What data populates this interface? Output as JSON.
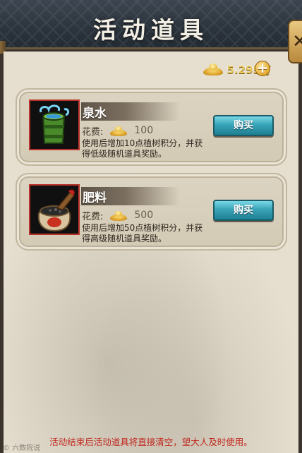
{
  "header": {
    "title": "活动道具",
    "close_label": "✕"
  },
  "currency": {
    "amount": "5.295万",
    "plus_label": "+"
  },
  "items": [
    {
      "name": "泉水",
      "cost_label": "花费:",
      "cost_value": "100",
      "description": "使用后增加10点植树积分，并获得低级随机道具奖励。",
      "buy_label": "购买",
      "icon": "bamboo-water-bucket-icon"
    },
    {
      "name": "肥料",
      "cost_label": "花费:",
      "cost_value": "500",
      "description": "使用后增加50点植树积分，并获得高级随机道具奖励。",
      "buy_label": "购买",
      "icon": "fertilizer-sack-icon"
    }
  ],
  "footer": {
    "notice": "活动结束后活动道具将直接清空，望大人及时使用。"
  },
  "watermark": "© 六数院说",
  "colors": {
    "accent_gold": "#e8c860",
    "buy_button": "#3aa4b8",
    "notice_red": "#c0281e"
  }
}
